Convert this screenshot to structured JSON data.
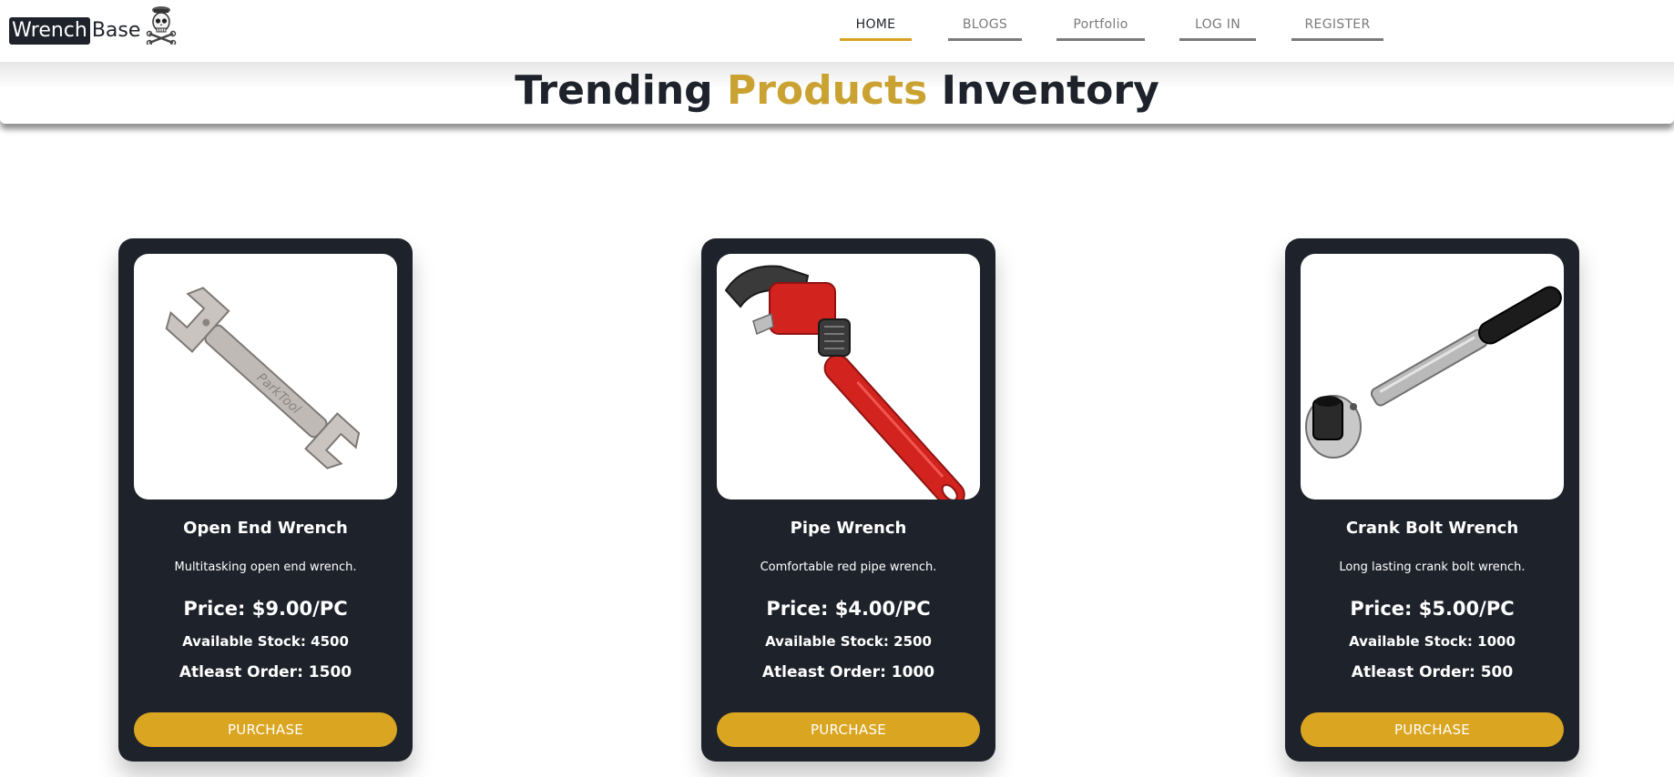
{
  "brand": {
    "highlight": "Wrench",
    "rest": "Base"
  },
  "nav": {
    "items": [
      {
        "label": "HOME",
        "active": true
      },
      {
        "label": "BLOGS",
        "active": false
      },
      {
        "label": "Portfolio",
        "active": false
      },
      {
        "label": "LOG IN",
        "active": false
      },
      {
        "label": "REGISTER",
        "active": false
      }
    ]
  },
  "heading": {
    "part1": "Trending ",
    "accent": "Products",
    "part2": " Inventory"
  },
  "products": [
    {
      "name": "Open End Wrench",
      "description": "Multitasking open end wrench.",
      "price": "Price: $9.00/PC",
      "stock": "Available Stock: 4500",
      "min_order": "Atleast Order: 1500",
      "button_label": "PURCHASE",
      "image_icon": "open-end-wrench-image"
    },
    {
      "name": "Pipe Wrench",
      "description": "Comfortable red pipe wrench.",
      "price": "Price: $4.00/PC",
      "stock": "Available Stock: 2500",
      "min_order": "Atleast Order: 1000",
      "button_label": "PURCHASE",
      "image_icon": "pipe-wrench-image"
    },
    {
      "name": "Crank Bolt Wrench",
      "description": "Long lasting crank bolt wrench.",
      "price": "Price: $5.00/PC",
      "stock": "Available Stock: 1000",
      "min_order": "Atleast Order: 500",
      "button_label": "PURCHASE",
      "image_icon": "crank-bolt-wrench-image"
    }
  ],
  "colors": {
    "dark": "#1e222b",
    "accent": "#daa520",
    "heading_accent": "#c9a232",
    "nav_muted": "#7a7a7a"
  }
}
